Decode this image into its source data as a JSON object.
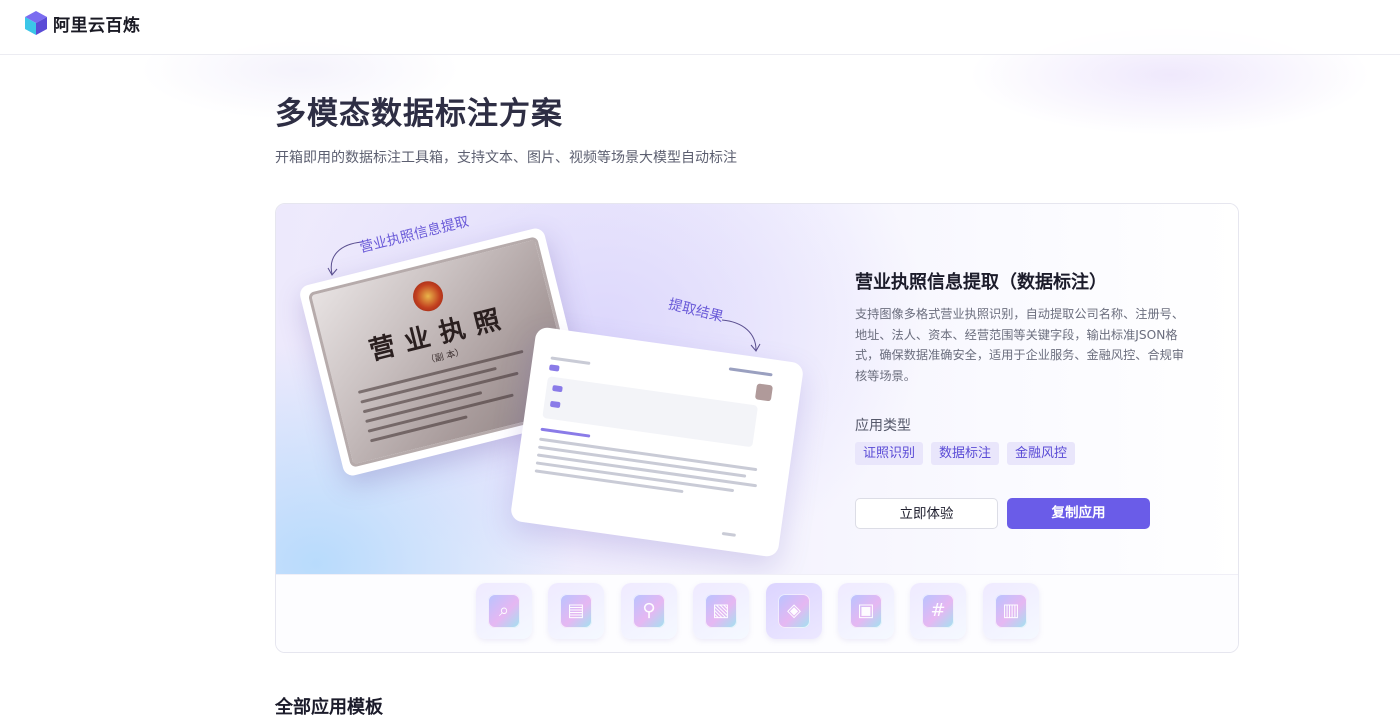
{
  "header": {
    "brand": "阿里云百炼"
  },
  "page": {
    "title": "多模态数据标注方案",
    "subtitle": "开箱即用的数据标注工具箱，支持文本、图片、视频等场景大模型自动标注"
  },
  "featured": {
    "illustration": {
      "callout_input": "营业执照信息提取",
      "callout_output": "提取结果",
      "license_title": "营业执照",
      "license_sub": "（副  本）"
    },
    "title": "营业执照信息提取（数据标注）",
    "description": "支持图像多格式营业执照识别，自动提取公司名称、注册号、地址、法人、资本、经营范围等关键字段，输出标准JSON格式，确保数据准确安全，适用于企业服务、金融风控、合规审核等场景。",
    "type_label": "应用类型",
    "tags": [
      "证照识别",
      "数据标注",
      "金融风控"
    ],
    "try_label": "立即体验",
    "copy_label": "复制应用",
    "thumbnails": [
      {
        "icon": "document-search-icon"
      },
      {
        "icon": "document-scan-icon"
      },
      {
        "icon": "magnifier-icon"
      },
      {
        "icon": "image-icon"
      },
      {
        "icon": "layers-icon",
        "active": true
      },
      {
        "icon": "card-icon"
      },
      {
        "icon": "hashtag-icon"
      },
      {
        "icon": "film-icon"
      }
    ]
  },
  "all_templates": {
    "title": "全部应用模板"
  },
  "colors": {
    "accent": "#6a5ce8",
    "tag_bg": "#e9e6fb",
    "tag_text": "#5a4bd6"
  }
}
